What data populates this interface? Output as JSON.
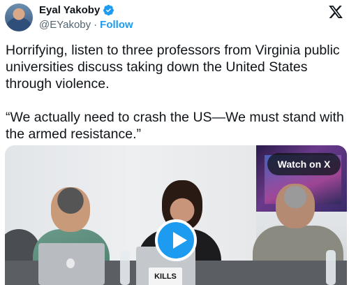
{
  "header": {
    "display_name": "Eyal Yakoby",
    "handle": "@EYakoby",
    "separator": "·",
    "follow_label": "Follow",
    "verified_color": "#1d9bf0"
  },
  "tweet": {
    "paragraph_1": "Horrifying, listen to three professors from Virginia public universities discuss taking down the United States through violence.",
    "paragraph_2": "“We actually need to crash the US—We must stand with the armed resistance.”"
  },
  "media": {
    "watch_label": "Watch on X",
    "sticker_text": "KILLS",
    "play_icon": "play-icon"
  },
  "colors": {
    "accent": "#1d9bf0",
    "text": "#0f1419",
    "muted": "#536471"
  }
}
